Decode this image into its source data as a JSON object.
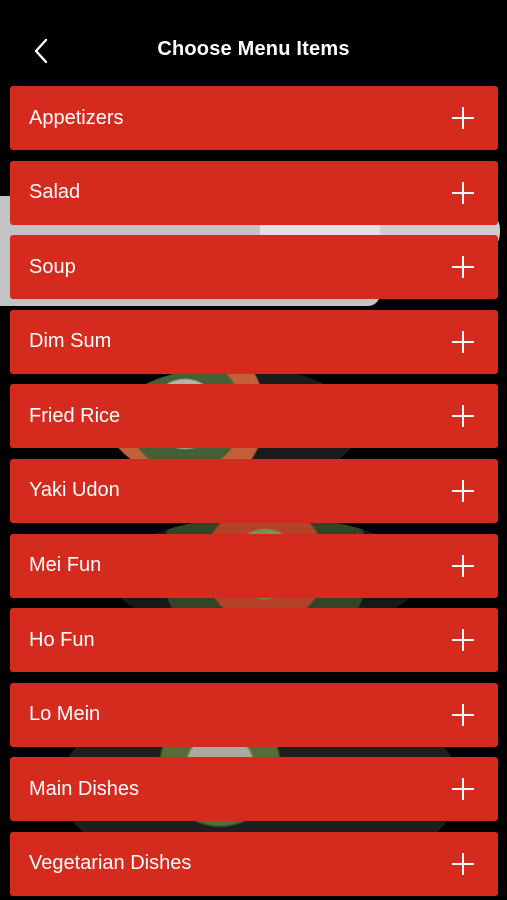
{
  "header": {
    "title": "Choose Menu Items",
    "back_icon": "chevron-left-icon"
  },
  "menu": {
    "items": [
      {
        "label": "Appetizers",
        "icon": "plus-icon"
      },
      {
        "label": "Salad",
        "icon": "plus-icon"
      },
      {
        "label": "Soup",
        "icon": "plus-icon"
      },
      {
        "label": "Dim Sum",
        "icon": "plus-icon"
      },
      {
        "label": "Fried Rice",
        "icon": "plus-icon"
      },
      {
        "label": "Yaki Udon",
        "icon": "plus-icon"
      },
      {
        "label": "Mei Fun",
        "icon": "plus-icon"
      },
      {
        "label": "Ho Fun",
        "icon": "plus-icon"
      },
      {
        "label": "Lo Mein",
        "icon": "plus-icon"
      },
      {
        "label": "Main Dishes",
        "icon": "plus-icon"
      },
      {
        "label": "Vegetarian Dishes",
        "icon": "plus-icon"
      }
    ]
  },
  "colors": {
    "accent": "#d52b1e",
    "background": "#000000",
    "text": "#ffffff"
  }
}
